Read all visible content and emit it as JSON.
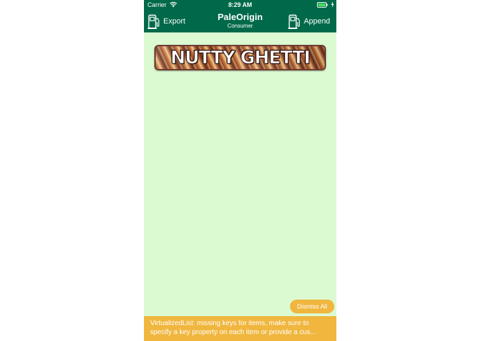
{
  "status_bar": {
    "carrier": "Carrier",
    "time": "8:29 AM"
  },
  "nav": {
    "title": "PaleOrigin",
    "subtitle": "Consumer",
    "left_button": {
      "label": "Export",
      "icon": "fuel-pump-icon"
    },
    "right_button": {
      "label": "Append",
      "icon": "fuel-pump-icon"
    }
  },
  "banner": {
    "text": "NUTTY GHETTI"
  },
  "dismiss_button": {
    "label": "Dismiss All"
  },
  "warning": {
    "line1": "VirtualizedList: missing keys for items, make sure to",
    "line2": "specify a key property on each item or provide a cus..."
  },
  "colors": {
    "header_bg": "#00694a",
    "content_bg": "#dcfad2",
    "warning_bg": "#f0b63e"
  }
}
